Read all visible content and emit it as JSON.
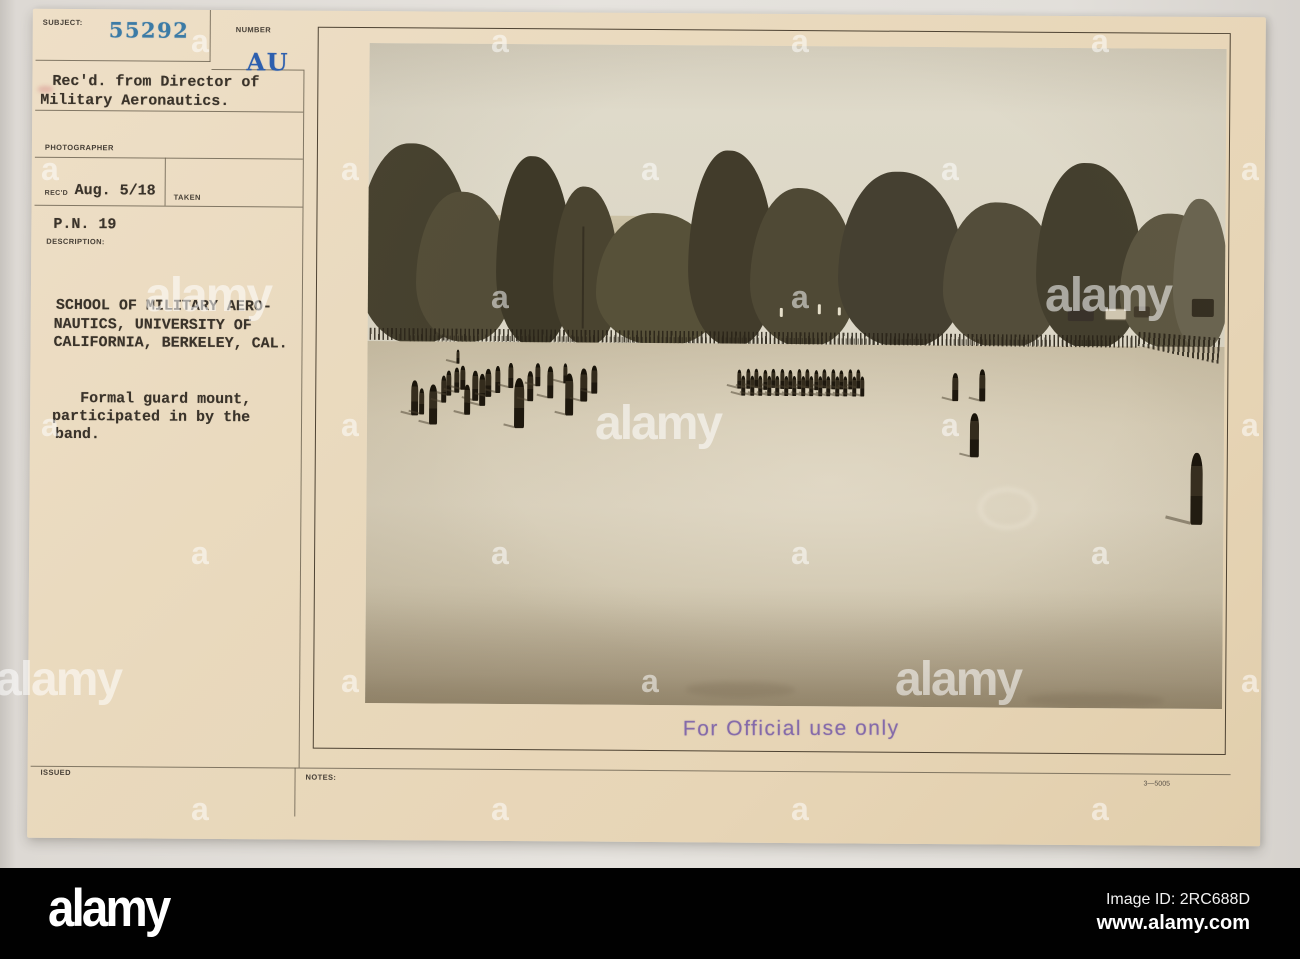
{
  "card": {
    "labels": {
      "subject": "SUBJECT:",
      "number": "NUMBER",
      "photographer": "PHOTOGRAPHER",
      "recd": "REC'D",
      "taken": "TAKEN",
      "description": "DESCRIPTION:",
      "issued": "ISSUED",
      "notes": "NOTES:"
    },
    "subject_number": "55292",
    "number_stamp": "AU",
    "received_lines": [
      "Rec'd. from Director of",
      "Military Aeronautics."
    ],
    "recd_date": "Aug. 5/18",
    "pn": "P.N. 19",
    "description_lines": [
      "SCHOOL OF MILITARY AERO-",
      "NAUTICS, UNIVERSITY OF",
      "CALIFORNIA, BERKELEY, CAL."
    ],
    "caption_lines": [
      "Formal guard mount,",
      "participated in by the",
      "band."
    ],
    "official_stamp": "For Official use only",
    "form_number": "3—5005",
    "colors": {
      "card": "#e9d9bd",
      "subject_ink": "#3c7ba6",
      "stamp_ink": "#2d5fae",
      "official_stamp_ink": "#7a5fa0"
    }
  },
  "photo": {
    "scene_elements": [
      "sky",
      "trees",
      "classical-building",
      "flagpole",
      "troop-line",
      "band-formation",
      "infantry-ranks",
      "saluting-officers",
      "officer-of-the-day",
      "parade-ground",
      "vehicles"
    ]
  },
  "watermark": {
    "tile_letter": "a",
    "brand_word": "alamy"
  },
  "footer": {
    "logo": "alamy",
    "image_id": "Image ID: 2RC688D",
    "url": "www.alamy.com",
    "background": "#000000"
  }
}
